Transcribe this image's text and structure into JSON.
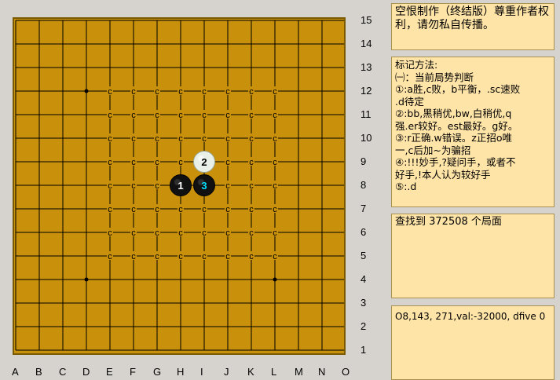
{
  "board": {
    "columns": [
      "A",
      "B",
      "C",
      "D",
      "E",
      "F",
      "G",
      "H",
      "I",
      "J",
      "K",
      "L",
      "M",
      "N",
      "O"
    ],
    "rows": [
      "15",
      "14",
      "13",
      "12",
      "11",
      "10",
      "9",
      "8",
      "7",
      "6",
      "5",
      "4",
      "3",
      "2",
      "1"
    ],
    "star_points": [
      "D12",
      "L12",
      "D4",
      "L4",
      "H8"
    ],
    "stones": [
      {
        "point": "H8",
        "color": "black",
        "number": "1",
        "number_color": "#ffffff"
      },
      {
        "point": "I9",
        "color": "white",
        "number": "2",
        "number_color": "#000000"
      },
      {
        "point": "I8",
        "color": "black",
        "number": "3",
        "number_color": "#00e0ff"
      }
    ],
    "marker_char": "c",
    "marked_points": [
      "E12",
      "F12",
      "G12",
      "H12",
      "I12",
      "J12",
      "K12",
      "L12",
      "E11",
      "F11",
      "G11",
      "H11",
      "I11",
      "J11",
      "K11",
      "L11",
      "E10",
      "F10",
      "G10",
      "H10",
      "I10",
      "J10",
      "K10",
      "L10",
      "E9",
      "F9",
      "G9",
      "H9",
      "J9",
      "K9",
      "L9",
      "E8",
      "F8",
      "G8",
      "J8",
      "K8",
      "L8",
      "E7",
      "F7",
      "G7",
      "H7",
      "I7",
      "J7",
      "K7",
      "L7",
      "E6",
      "F6",
      "G6",
      "H6",
      "I6",
      "J6",
      "K6",
      "L6",
      "E5",
      "F5",
      "G5",
      "H5",
      "I5",
      "J5",
      "K5",
      "L5"
    ],
    "colors": {
      "board": "#c8900b",
      "grid": "#000000",
      "black_stone": "#111111",
      "white_stone": "#e8f0e8"
    }
  },
  "credit_panel": {
    "text": "空恨制作（终结版）尊重作者权利，请勿私自传播。"
  },
  "notes_panel": {
    "lines": [
      "标记方法:",
      "㈠：当前局势判断",
      "①:a胜,c败，b平衡，.sc速败",
      ".d待定",
      "②:bb,黑稍优,bw,白稍优,q",
      "强.er较好。est最好。g好。",
      "③:r正确.w错误。z正招o唯",
      "一,c后加~为骗招",
      "④:!!!妙手,?疑问手，或者不",
      "好手,!本人认为较好手",
      "⑤:.d"
    ]
  },
  "found_panel": {
    "text": "查找到 372508 个局面"
  },
  "eval_panel": {
    "text": "O8,143, 271,val:-32000, dfive 0"
  }
}
